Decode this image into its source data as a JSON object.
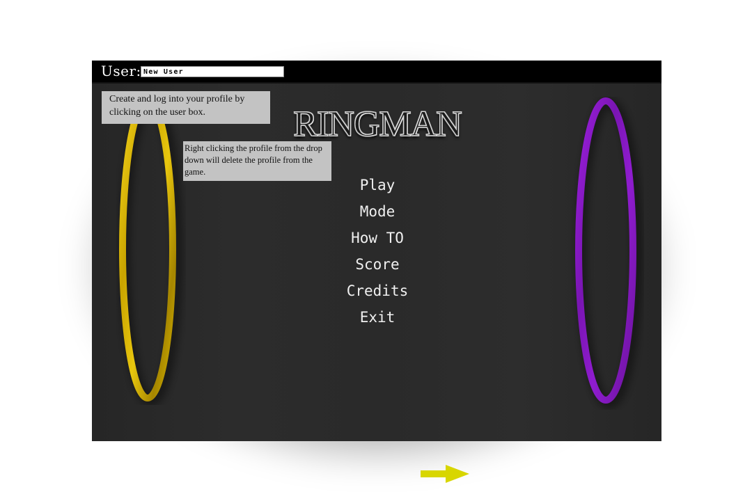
{
  "user_bar": {
    "label": "User:",
    "input_value": "New User"
  },
  "tooltips": {
    "login_hint": "Create and log into your profile by clicking on the user box.",
    "delete_hint": "Right clicking the profile from the drop down will delete the profile from the game."
  },
  "title": "RINGMAN",
  "menu": {
    "items": [
      {
        "label": "Play"
      },
      {
        "label": "Mode"
      },
      {
        "label": "How TO"
      },
      {
        "label": "Score"
      },
      {
        "label": "Credits"
      },
      {
        "label": "Exit"
      }
    ]
  },
  "decorations": {
    "left_ring": {
      "icon": "yellow-ring-icon",
      "color": "#d4b300"
    },
    "right_ring": {
      "icon": "purple-ring-icon",
      "color": "#8a1bc9"
    },
    "arrow": {
      "icon": "right-arrow-icon",
      "color": "#d8d600"
    }
  }
}
